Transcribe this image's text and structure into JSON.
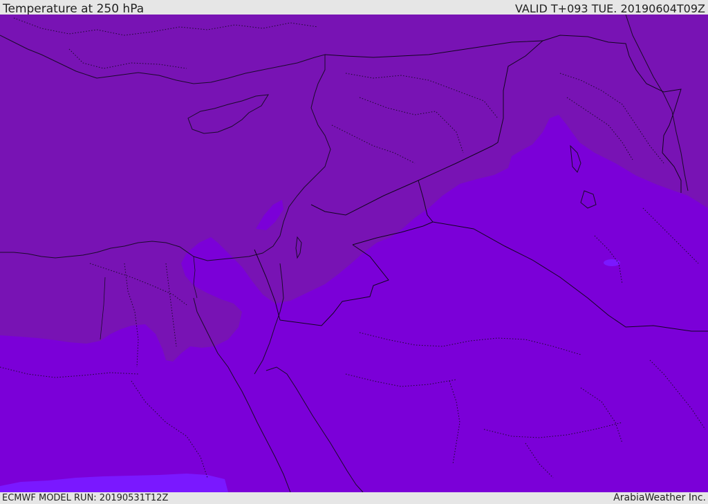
{
  "header": {
    "title": "Temperature at 250 hPa",
    "valid_time": "VALID T+093 TUE. 20190604T09Z"
  },
  "footer": {
    "model_run": "ECMWF MODEL RUN: 20190531T12Z",
    "credit": "ArabiaWeather Inc."
  },
  "map": {
    "colors": {
      "warm_band": "#7813b4",
      "mid_band": "#7b00d8",
      "cold_band": "#7a18ff",
      "coastline": "#1a0a2a",
      "border": "#12051f"
    }
  }
}
